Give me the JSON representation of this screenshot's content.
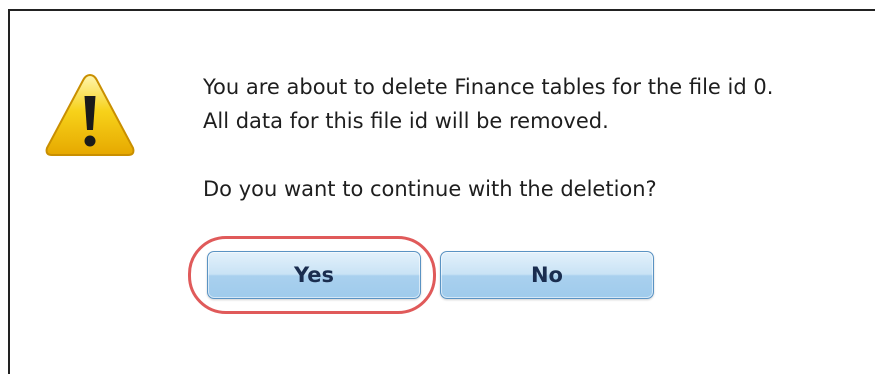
{
  "dialog": {
    "message_line_1": "You are about to delete Finance tables for the file id 0.",
    "message_line_2": "All data for this file id will be removed.",
    "question": "Do you want to continue with the deletion?",
    "icon": "warning-icon"
  },
  "buttons": {
    "yes_label": "Yes",
    "no_label": "No"
  },
  "colors": {
    "warning_fill": "#f5c800",
    "button_border": "#5a93c3",
    "highlight_ring": "#e05a5a"
  }
}
